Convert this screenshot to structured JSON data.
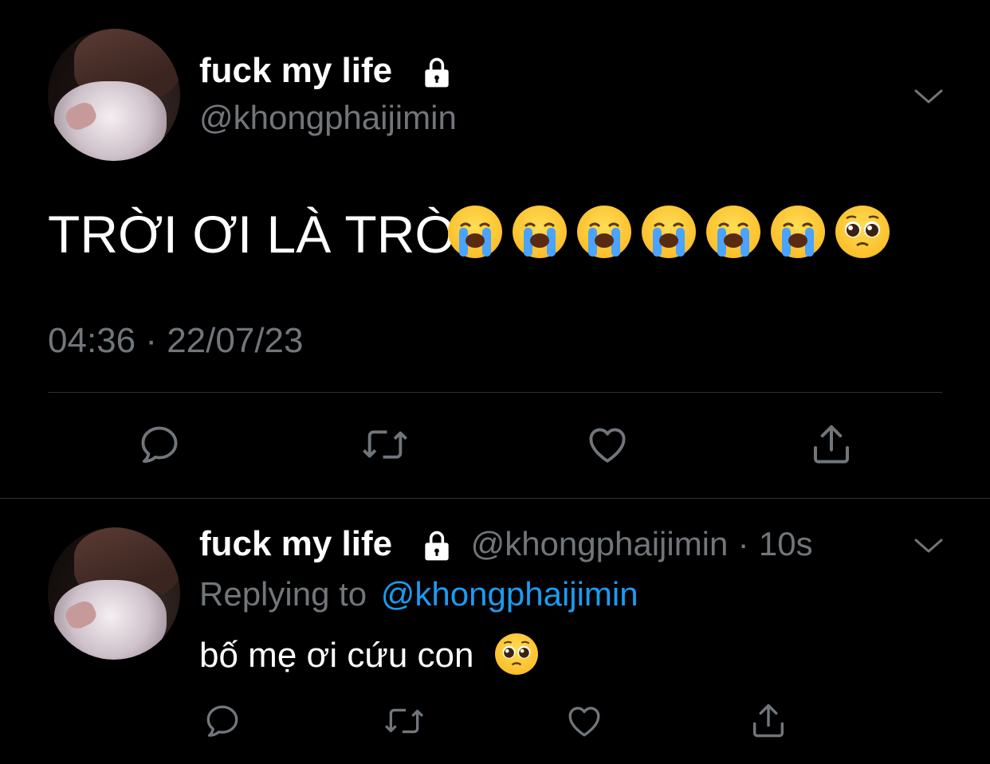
{
  "main_tweet": {
    "display_name": "fuck my life",
    "handle": "@khongphaijimin",
    "text": "TRỜI ƠI LÀ TRỜI",
    "emojis": [
      "loudly-crying-face",
      "loudly-crying-face",
      "loudly-crying-face",
      "loudly-crying-face",
      "loudly-crying-face",
      "loudly-crying-face",
      "pleading-face"
    ],
    "timestamp": "04:36 · 22/07/23"
  },
  "reply_tweet": {
    "display_name": "fuck my life",
    "handle": "@khongphaijimin",
    "separator": "·",
    "time_ago": "10s",
    "replying_to_label": "Replying to",
    "replying_to_handle": "@khongphaijimin",
    "text": "bố mẹ ơi cứu con",
    "emojis": [
      "pleading-face"
    ]
  },
  "actions": [
    "reply-icon",
    "retweet-icon",
    "like-icon",
    "share-icon"
  ],
  "colors": {
    "background": "#000000",
    "text": "#e7e9ea",
    "muted": "#71767b",
    "link": "#1d9bf0",
    "divider": "#2f3336"
  }
}
